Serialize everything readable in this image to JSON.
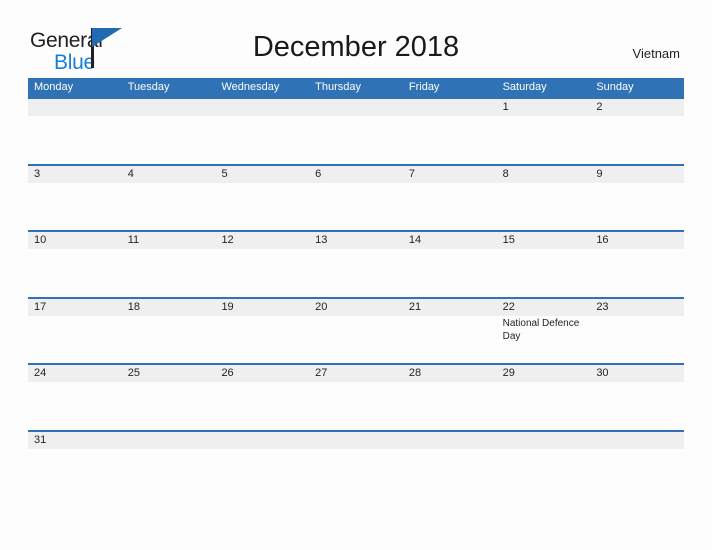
{
  "brand": {
    "line1": "General",
    "line2": "Blue",
    "flag_icon": "blue-flag-triangle-icon"
  },
  "header": {
    "title": "December 2018",
    "country": "Vietnam"
  },
  "colors": {
    "header_blue": "#2f72b5",
    "row_separator_blue": "#2f72b5",
    "daynum_band_gray": "#efefef",
    "brand_blue": "#1b7ed6",
    "page_background": "#fdfdfd",
    "text": "#231f20"
  },
  "calendar": {
    "weekdays": [
      "Monday",
      "Tuesday",
      "Wednesday",
      "Thursday",
      "Friday",
      "Saturday",
      "Sunday"
    ],
    "weeks": [
      {
        "days": [
          {
            "num": "",
            "event": ""
          },
          {
            "num": "",
            "event": ""
          },
          {
            "num": "",
            "event": ""
          },
          {
            "num": "",
            "event": ""
          },
          {
            "num": "",
            "event": ""
          },
          {
            "num": "1",
            "event": ""
          },
          {
            "num": "2",
            "event": ""
          }
        ]
      },
      {
        "days": [
          {
            "num": "3",
            "event": ""
          },
          {
            "num": "4",
            "event": ""
          },
          {
            "num": "5",
            "event": ""
          },
          {
            "num": "6",
            "event": ""
          },
          {
            "num": "7",
            "event": ""
          },
          {
            "num": "8",
            "event": ""
          },
          {
            "num": "9",
            "event": ""
          }
        ]
      },
      {
        "days": [
          {
            "num": "10",
            "event": ""
          },
          {
            "num": "11",
            "event": ""
          },
          {
            "num": "12",
            "event": ""
          },
          {
            "num": "13",
            "event": ""
          },
          {
            "num": "14",
            "event": ""
          },
          {
            "num": "15",
            "event": ""
          },
          {
            "num": "16",
            "event": ""
          }
        ]
      },
      {
        "days": [
          {
            "num": "17",
            "event": ""
          },
          {
            "num": "18",
            "event": ""
          },
          {
            "num": "19",
            "event": ""
          },
          {
            "num": "20",
            "event": ""
          },
          {
            "num": "21",
            "event": ""
          },
          {
            "num": "22",
            "event": "National Defence Day"
          },
          {
            "num": "23",
            "event": ""
          }
        ]
      },
      {
        "days": [
          {
            "num": "24",
            "event": ""
          },
          {
            "num": "25",
            "event": ""
          },
          {
            "num": "26",
            "event": ""
          },
          {
            "num": "27",
            "event": ""
          },
          {
            "num": "28",
            "event": ""
          },
          {
            "num": "29",
            "event": ""
          },
          {
            "num": "30",
            "event": ""
          }
        ]
      },
      {
        "days": [
          {
            "num": "31",
            "event": ""
          },
          {
            "num": "",
            "event": ""
          },
          {
            "num": "",
            "event": ""
          },
          {
            "num": "",
            "event": ""
          },
          {
            "num": "",
            "event": ""
          },
          {
            "num": "",
            "event": ""
          },
          {
            "num": "",
            "event": ""
          }
        ]
      }
    ]
  }
}
